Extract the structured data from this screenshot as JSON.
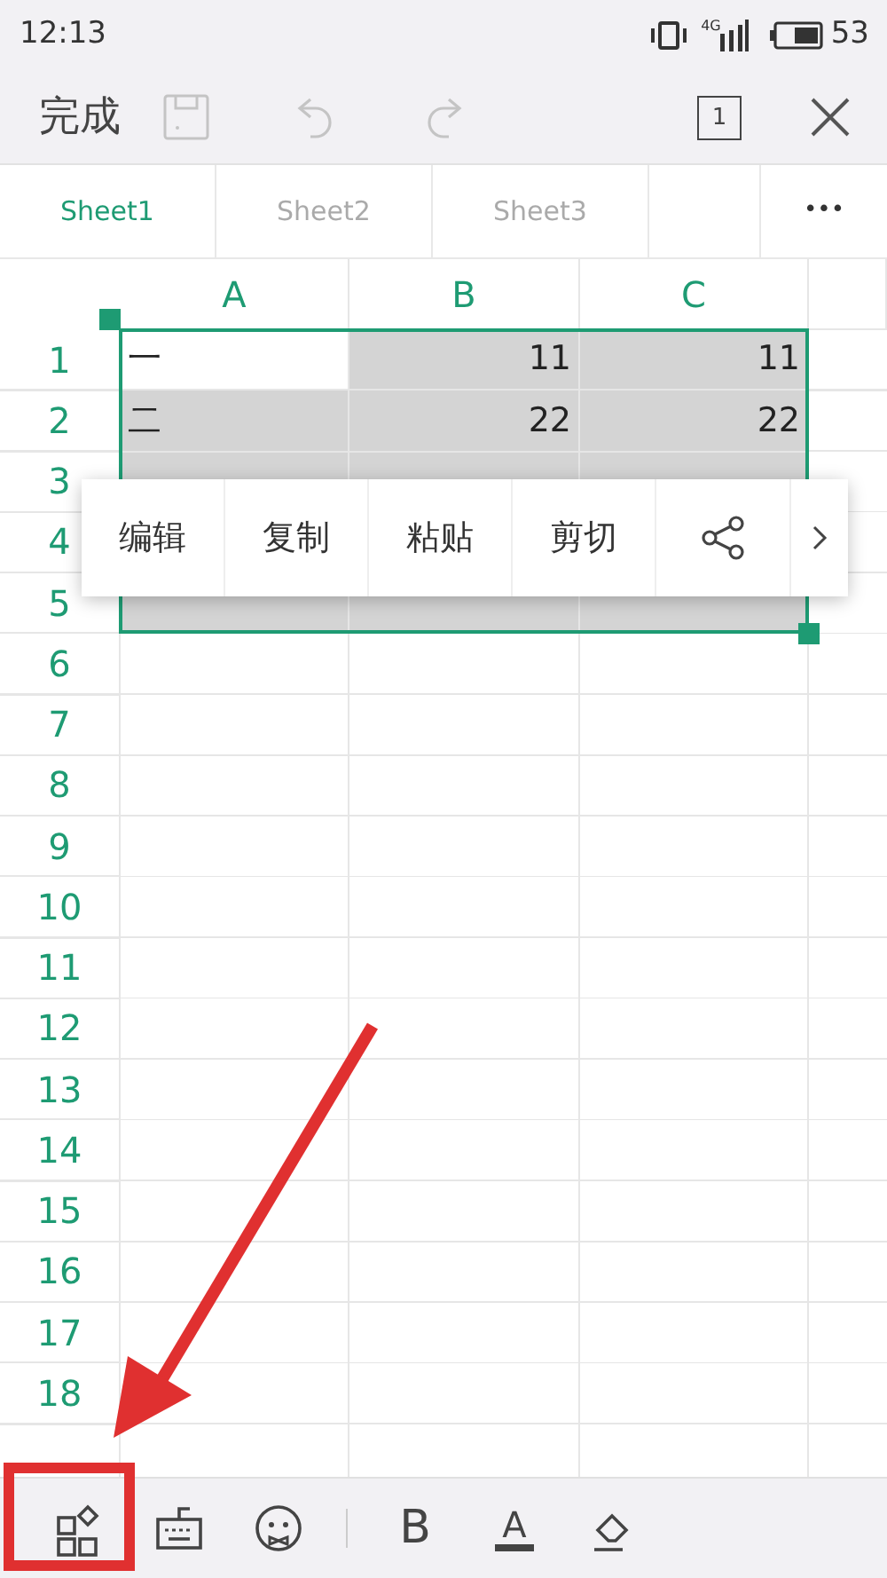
{
  "status_bar": {
    "time": "12:13",
    "network": "4G",
    "battery": "53"
  },
  "toolbar": {
    "done": "完成",
    "save_disabled": true,
    "undo_disabled": true,
    "redo_disabled": true,
    "sheet_count": "1"
  },
  "sheet_tabs": [
    {
      "label": "Sheet1",
      "selected": true
    },
    {
      "label": "Sheet2",
      "selected": false
    },
    {
      "label": "Sheet3",
      "selected": false
    }
  ],
  "more_tabs": "•••",
  "columns": [
    "A",
    "B",
    "C"
  ],
  "rows": [
    {
      "label": "1",
      "cells": [
        {
          "text": "一",
          "selected": true,
          "active": true
        },
        {
          "text": "11",
          "selected": true
        },
        {
          "text": "11",
          "selected": true
        }
      ]
    },
    {
      "label": "2",
      "cells": [
        {
          "text": "二",
          "selected": true
        },
        {
          "text": "22",
          "selected": true
        },
        {
          "text": "22",
          "selected": true
        }
      ]
    },
    {
      "label": "3",
      "cells": [
        {
          "selected": true
        },
        {
          "selected": true
        },
        {
          "selected": true
        }
      ]
    },
    {
      "label": "4"
    },
    {
      "label": "5",
      "cells": [
        {
          "selected": true
        },
        {
          "selected": true
        },
        {
          "selected": true
        }
      ]
    },
    {
      "label": "6"
    },
    {
      "label": "7"
    },
    {
      "label": "8"
    },
    {
      "label": "9"
    },
    {
      "label": "10"
    },
    {
      "label": "11"
    },
    {
      "label": "12"
    },
    {
      "label": "13"
    },
    {
      "label": "14"
    },
    {
      "label": "15"
    },
    {
      "label": "16"
    },
    {
      "label": "17"
    },
    {
      "label": "18"
    }
  ],
  "context_menu": [
    {
      "kind": "text",
      "label": "编辑"
    },
    {
      "kind": "text",
      "label": "复制"
    },
    {
      "kind": "text",
      "label": "粘贴"
    },
    {
      "kind": "text",
      "label": "剪切"
    },
    {
      "kind": "share"
    },
    {
      "kind": "more"
    }
  ],
  "bottom_toolbar": [
    {
      "kind": "apps",
      "highlighted": true
    },
    {
      "kind": "keyboard"
    },
    {
      "kind": "emoji"
    },
    {
      "kind": "divider"
    },
    {
      "kind": "bold",
      "label": "B"
    },
    {
      "kind": "font-color",
      "label": "A"
    },
    {
      "kind": "eraser"
    }
  ],
  "annotation": {
    "arrow": true
  }
}
